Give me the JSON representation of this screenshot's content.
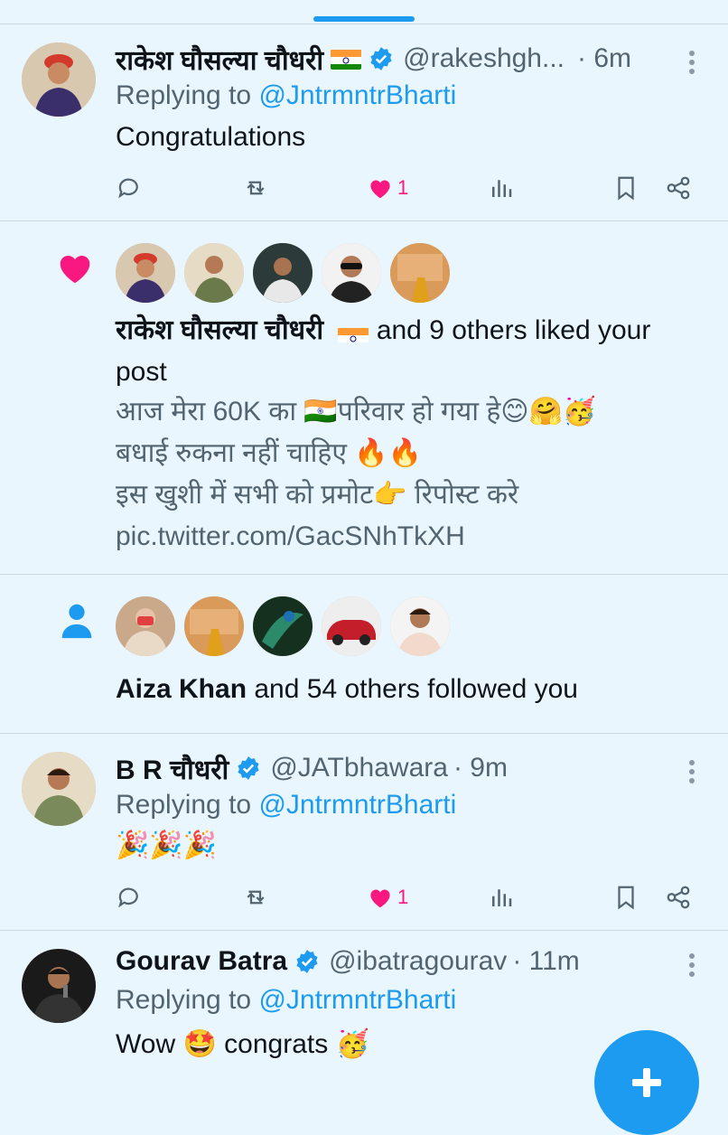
{
  "notifications": [
    {
      "type": "reply",
      "author_name": "राकेश घौसल्या चौधरी",
      "handle": "@rakeshgh...",
      "time": "· 6m",
      "replying_label": "Replying to",
      "replying_to": "@JntrmntrBharti",
      "text": "Congratulations",
      "like_count": "1"
    },
    {
      "type": "like",
      "actor_name": "राकेश घौसल्या चौधरी",
      "summary": "and 9 others liked your",
      "summary_line2": "post",
      "post_lines": [
        "आज मेरा 60K का 🇮🇳परिवार हो गया हे😊🤗🥳",
        "बधाई रुकना नहीं चाहिए 🔥🔥",
        "इस खुशी में सभी को प्रमोट👉 रिपोस्ट करे",
        "pic.twitter.com/GacSNhTkXH"
      ]
    },
    {
      "type": "follow",
      "actor_name": "Aiza Khan",
      "summary": "and 54 others followed you"
    },
    {
      "type": "reply",
      "author_name": "B R चौधरी",
      "handle": "@JATbhawara",
      "time": "· 9m",
      "replying_label": "Replying to",
      "replying_to": "@JntrmntrBharti",
      "text": "🎉🎉🎉",
      "like_count": "1"
    },
    {
      "type": "reply",
      "author_name": "Gourav Batra",
      "handle": "@ibatragourav",
      "time": "· 11m",
      "replying_label": "Replying to",
      "replying_to": "@JntrmntrBharti",
      "text": "Wow 🤩 congrats 🥳"
    }
  ],
  "colors": {
    "background": "#e9f6fd",
    "accent": "#1d9bf0",
    "like": "#f91880",
    "secondary_text": "#536471"
  },
  "icons": [
    "reply-icon",
    "retweet-icon",
    "heart-icon",
    "views-icon",
    "bookmark-icon",
    "share-icon",
    "more-icon",
    "verified-icon",
    "person-icon",
    "compose-icon"
  ]
}
